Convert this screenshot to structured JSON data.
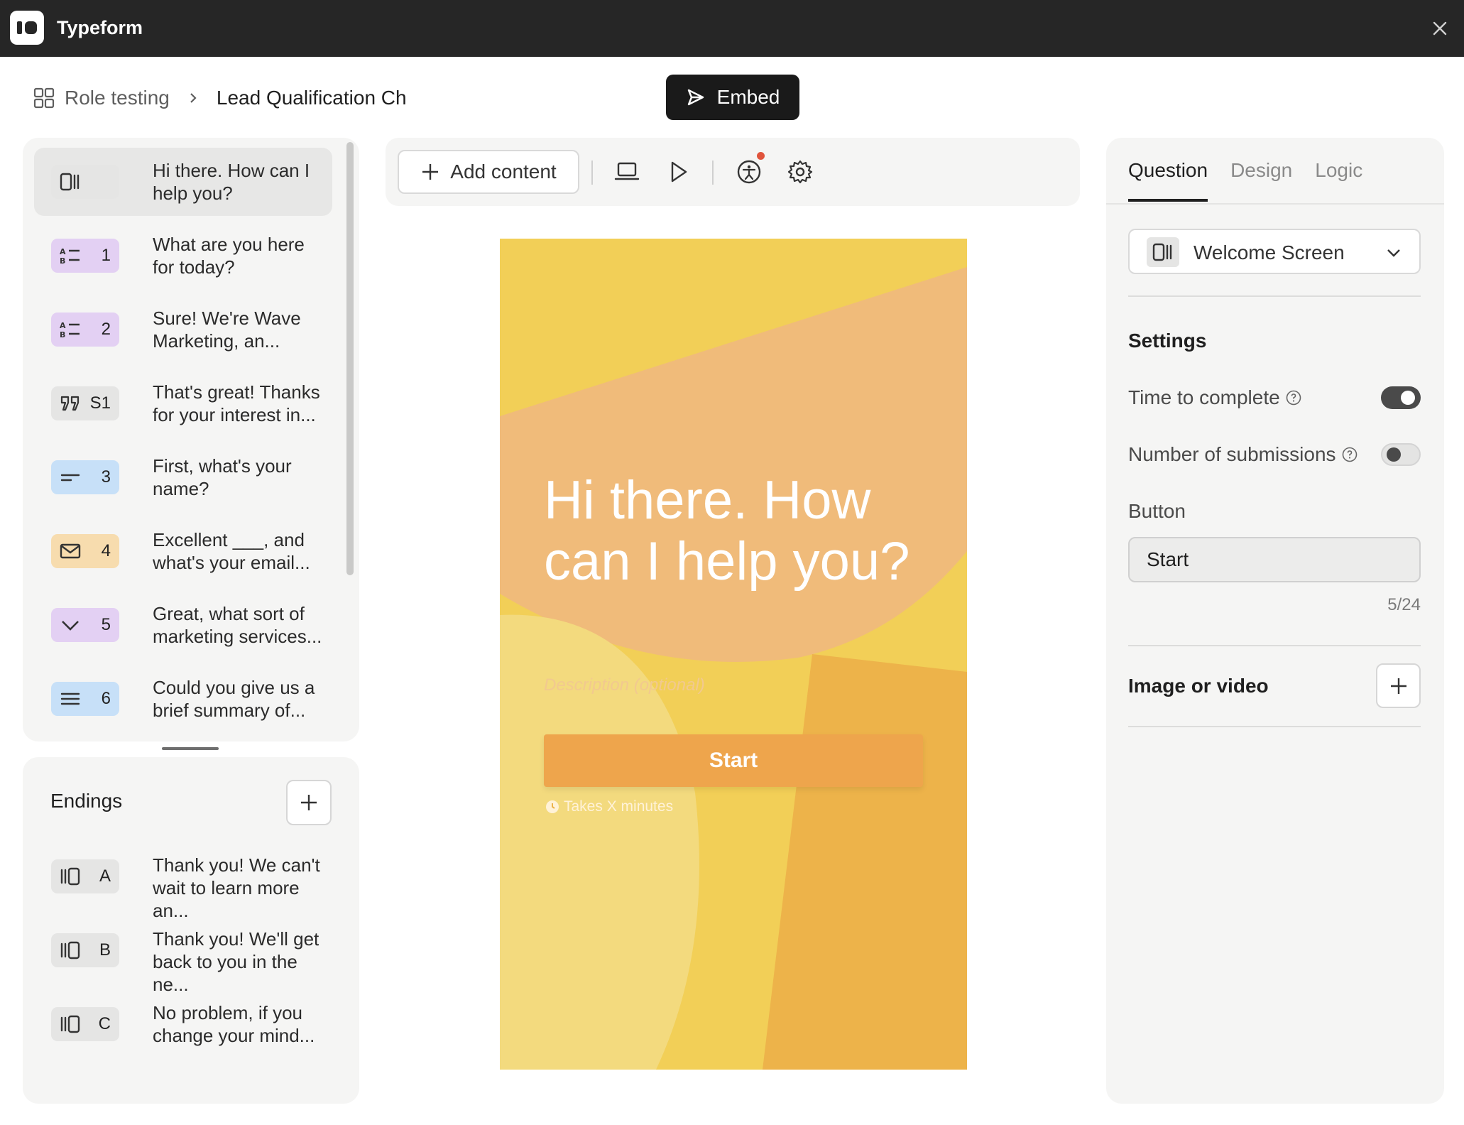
{
  "app": {
    "title": "Typeform"
  },
  "breadcrumb": {
    "workspace": "Role testing",
    "form": "Lead Qualification Ch"
  },
  "embed": {
    "label": "Embed"
  },
  "questions": [
    {
      "badge": "",
      "text": "Hi there. How can I help you?",
      "icon": "welcome-screen-icon",
      "color": "#e5e5e4",
      "active": true
    },
    {
      "badge": "1",
      "text": "What are you here for today?",
      "icon": "multiple-choice-icon",
      "color": "#e3d0f3"
    },
    {
      "badge": "2",
      "text": "Sure! We're Wave Marketing, an...",
      "icon": "multiple-choice-icon",
      "color": "#e3d0f3"
    },
    {
      "badge": "S1",
      "text": "That's great! Thanks for your interest in...",
      "icon": "statement-quote-icon",
      "color": "#e5e5e4"
    },
    {
      "badge": "3",
      "text": "First, what's your name?",
      "icon": "short-text-icon",
      "color": "#c7e0f8"
    },
    {
      "badge": "4",
      "text": "Excellent ___, and what's your email...",
      "icon": "email-icon",
      "color": "#f7dcae"
    },
    {
      "badge": "5",
      "text": "Great, what sort of marketing services...",
      "icon": "dropdown-icon",
      "color": "#e3d0f3"
    },
    {
      "badge": "6",
      "text": "Could you give us a brief summary of...",
      "icon": "long-text-icon",
      "color": "#c7e0f8"
    }
  ],
  "endings": {
    "title": "Endings",
    "items": [
      {
        "badge": "A",
        "text": "Thank you! We can't wait to learn more an...",
        "icon": "ending-screen-icon"
      },
      {
        "badge": "B",
        "text": "Thank you! We'll get back to you in the ne...",
        "icon": "ending-screen-icon"
      },
      {
        "badge": "C",
        "text": "No problem, if you change your mind...",
        "icon": "ending-screen-icon"
      }
    ]
  },
  "toolbar": {
    "add_content": "Add content"
  },
  "preview": {
    "title": "Hi there. How can I help you?",
    "description_placeholder": "Description (optional)",
    "button": "Start",
    "time": "Takes X minutes"
  },
  "right_panel": {
    "tabs": [
      "Question",
      "Design",
      "Logic"
    ],
    "active_tab": "Question",
    "type_select": "Welcome Screen",
    "settings_title": "Settings",
    "time_to_complete": {
      "label": "Time to complete",
      "on": true
    },
    "number_of_submissions": {
      "label": "Number of submissions",
      "on": false
    },
    "button_label": "Button",
    "button_value": "Start",
    "char_count": "5/24",
    "media_label": "Image or video"
  }
}
